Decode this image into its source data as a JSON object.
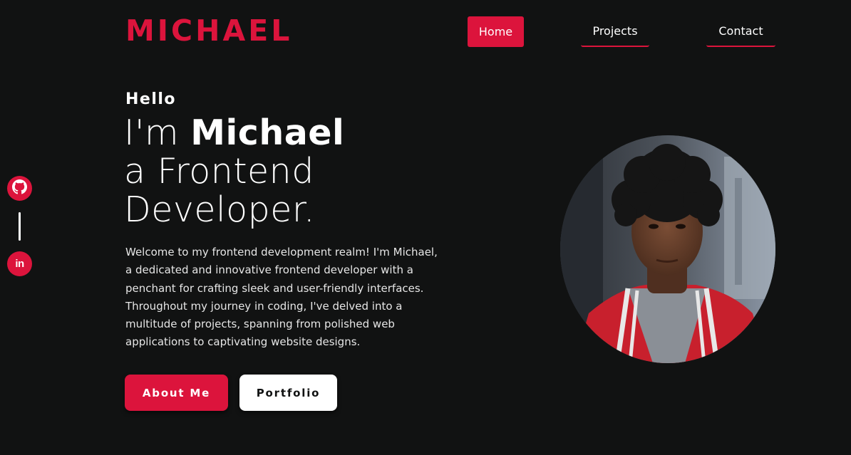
{
  "header": {
    "logo": "MICHAEL",
    "nav": [
      {
        "label": "Home",
        "active": true
      },
      {
        "label": "Projects",
        "active": false
      },
      {
        "label": "Contact",
        "active": false
      }
    ]
  },
  "social": {
    "items": [
      {
        "name": "github-icon"
      },
      {
        "name": "linkedin-icon",
        "glyph": "in"
      }
    ]
  },
  "hero": {
    "greeting": "Hello",
    "line1_prefix": "I'm",
    "line1_name": "Michael",
    "line2": "a Frontend",
    "line3": "Developer.",
    "intro_lines": [
      "Welcome to my frontend development realm! I'm Michael,",
      "a dedicated and innovative frontend developer with a",
      "penchant for crafting sleek and user-friendly interfaces.",
      "Throughout my journey in coding, I've delved into a",
      "multitude of projects, spanning from polished web",
      "applications to captivating website designs."
    ],
    "buttons": {
      "about": "About Me",
      "portfolio": "Portfolio"
    }
  },
  "colors": {
    "accent": "#dc143c",
    "background": "#111212",
    "text": "#ffffff"
  }
}
